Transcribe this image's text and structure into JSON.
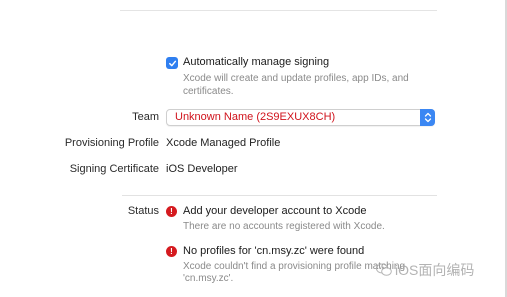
{
  "signing": {
    "auto_manage_label": "Automatically manage signing",
    "auto_manage_checked": true,
    "auto_manage_desc": "Xcode will create and update profiles, app IDs, and certificates."
  },
  "team": {
    "label": "Team",
    "selected": "Unknown Name (2S9EXUX8CH)"
  },
  "provisioning": {
    "label": "Provisioning Profile",
    "value": "Xcode Managed Profile"
  },
  "certificate": {
    "label": "Signing Certificate",
    "value": "iOS Developer"
  },
  "status": {
    "label": "Status",
    "messages": [
      {
        "title": "Add your developer account to Xcode",
        "desc": "There are no accounts registered with Xcode."
      },
      {
        "title": "No profiles for 'cn.msy.zc' were found",
        "desc": "Xcode couldn't find a provisioning profile matching 'cn.msy.zc'."
      }
    ]
  },
  "watermark": {
    "text": "iOS面向编码"
  },
  "colors": {
    "accent": "#2f7ff0",
    "error": "#d51a1f",
    "team_text": "#d0121b"
  }
}
